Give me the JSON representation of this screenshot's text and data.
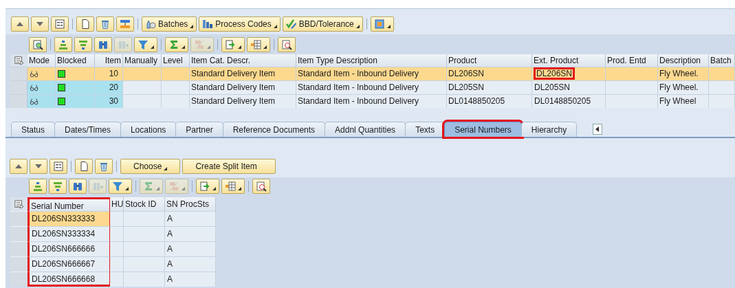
{
  "header_toolbar": {
    "buttons": [
      {
        "label": "Batches",
        "dropdown": true
      },
      {
        "label": "Process Codes",
        "dropdown": true
      },
      {
        "label": "BBD/Tolerance",
        "dropdown": true
      }
    ]
  },
  "items_table": {
    "columns": [
      "Mode",
      "Blocked",
      "Item",
      "Manually",
      "Level",
      "Item Cat. Descr.",
      "Item Type Description",
      "Product",
      "Ext. Product",
      "Prod. Entd",
      "Description",
      "Batch"
    ],
    "rows": [
      {
        "selected": true,
        "blocked": false,
        "item": "10",
        "item_cat_descr": "Standard Delivery Item",
        "item_type_description": "Standard Item - Inbound Delivery",
        "product": "DL206SN",
        "ext_product": "DL206SN",
        "ext_product_highlighted": true,
        "description": "Fly Wheel."
      },
      {
        "selected": false,
        "blocked": false,
        "item": "20",
        "item_cat_descr": "Standard Delivery Item",
        "item_type_description": "Standard Item - Inbound Delivery",
        "product": "DL205SN",
        "ext_product": "DL205SN",
        "ext_product_highlighted": false,
        "description": "Fly Wheel."
      },
      {
        "selected": false,
        "blocked": false,
        "item": "30",
        "item_cat_descr": "Standard Delivery Item",
        "item_type_description": "Standard Item - Inbound Delivery",
        "product": "DL0148850205",
        "ext_product": "DL0148850205",
        "ext_product_highlighted": false,
        "description": "Fly Wheel"
      }
    ]
  },
  "tabs": [
    {
      "label": "Status",
      "selected": false,
      "highlighted": false
    },
    {
      "label": "Dates/Times",
      "selected": false,
      "highlighted": false
    },
    {
      "label": "Locations",
      "selected": false,
      "highlighted": false
    },
    {
      "label": "Partner",
      "selected": false,
      "highlighted": false
    },
    {
      "label": "Reference Documents",
      "selected": false,
      "highlighted": false
    },
    {
      "label": "Addnl Quantities",
      "selected": false,
      "highlighted": false
    },
    {
      "label": "Texts",
      "selected": false,
      "highlighted": false
    },
    {
      "label": "Serial Numbers",
      "selected": true,
      "highlighted": true
    },
    {
      "label": "Hierarchy",
      "selected": false,
      "highlighted": false
    }
  ],
  "serial_toolbar": {
    "buttons": [
      {
        "label": "Choose",
        "dropdown": true
      },
      {
        "label": "Create Split Item",
        "dropdown": false
      }
    ]
  },
  "serial_table": {
    "columns": [
      {
        "label": "Serial Number",
        "highlighted": true
      },
      {
        "label": "HU",
        "highlighted": false
      },
      {
        "label": "Stock ID",
        "highlighted": false
      },
      {
        "label": "SN ProcSts",
        "highlighted": false
      }
    ],
    "rows": [
      {
        "selected": true,
        "serial_number": "DL206SN333333",
        "sn_procsts": "A"
      },
      {
        "selected": false,
        "serial_number": "DL206SN333334",
        "sn_procsts": "A"
      },
      {
        "selected": false,
        "serial_number": "DL206SN666666",
        "sn_procsts": "A"
      },
      {
        "selected": false,
        "serial_number": "DL206SN666667",
        "sn_procsts": "A"
      },
      {
        "selected": false,
        "serial_number": "DL206SN666668",
        "sn_procsts": "A"
      }
    ]
  }
}
